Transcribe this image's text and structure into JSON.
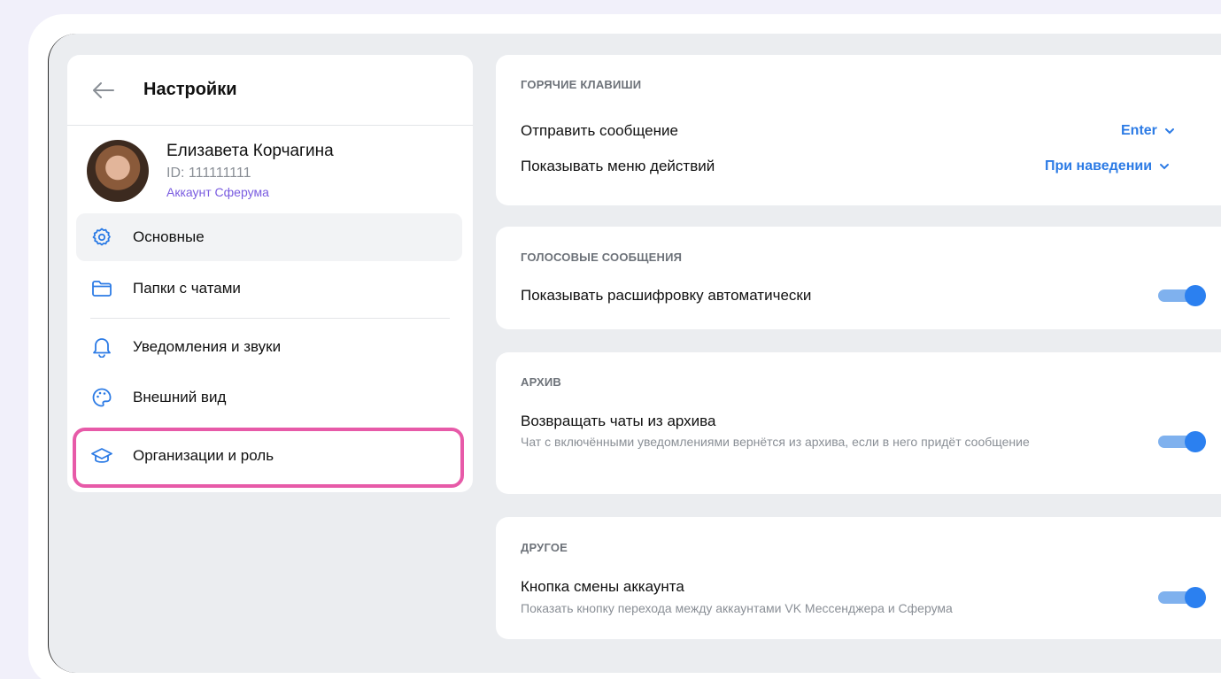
{
  "sidebar": {
    "title": "Настройки",
    "profile": {
      "name": "Елизавета Корчагина",
      "id": "ID: 111111111",
      "account_type": "Аккаунт Сферума"
    },
    "items": [
      {
        "label": "Основные",
        "icon": "gear-icon",
        "active": true
      },
      {
        "label": "Папки с чатами",
        "icon": "folder-icon"
      },
      {
        "label": "Уведомления и звуки",
        "icon": "bell-icon"
      },
      {
        "label": "Внешний вид",
        "icon": "palette-icon"
      },
      {
        "label": "Организации и роль",
        "icon": "graduation-cap-icon",
        "highlighted": true
      }
    ]
  },
  "main": {
    "hotkeys": {
      "header": "ГОРЯЧИЕ КЛАВИШИ",
      "send_label": "Отправить сообщение",
      "send_value": "Enter",
      "menu_label": "Показывать меню действий",
      "menu_value": "При наведении"
    },
    "voice": {
      "header": "ГОЛОСОВЫЕ СООБЩЕНИЯ",
      "transcript_label": "Показывать расшифровку автоматически",
      "transcript_on": true
    },
    "archive": {
      "header": "АРХИВ",
      "return_label": "Возвращать чаты из архива",
      "return_desc": "Чат с включёнными уведомлениями вернётся из архива, если в него придёт сообщение",
      "return_on": true
    },
    "other": {
      "header": "ДРУГОЕ",
      "switch_label": "Кнопка смены аккаунта",
      "switch_desc": "Показать кнопку перехода между аккаунтами VK Мессенджера и Сферума",
      "switch_on": true
    }
  },
  "colors": {
    "accent": "#2b80f0",
    "highlight": "#e75aa8",
    "account_link": "#7a5ce0"
  }
}
